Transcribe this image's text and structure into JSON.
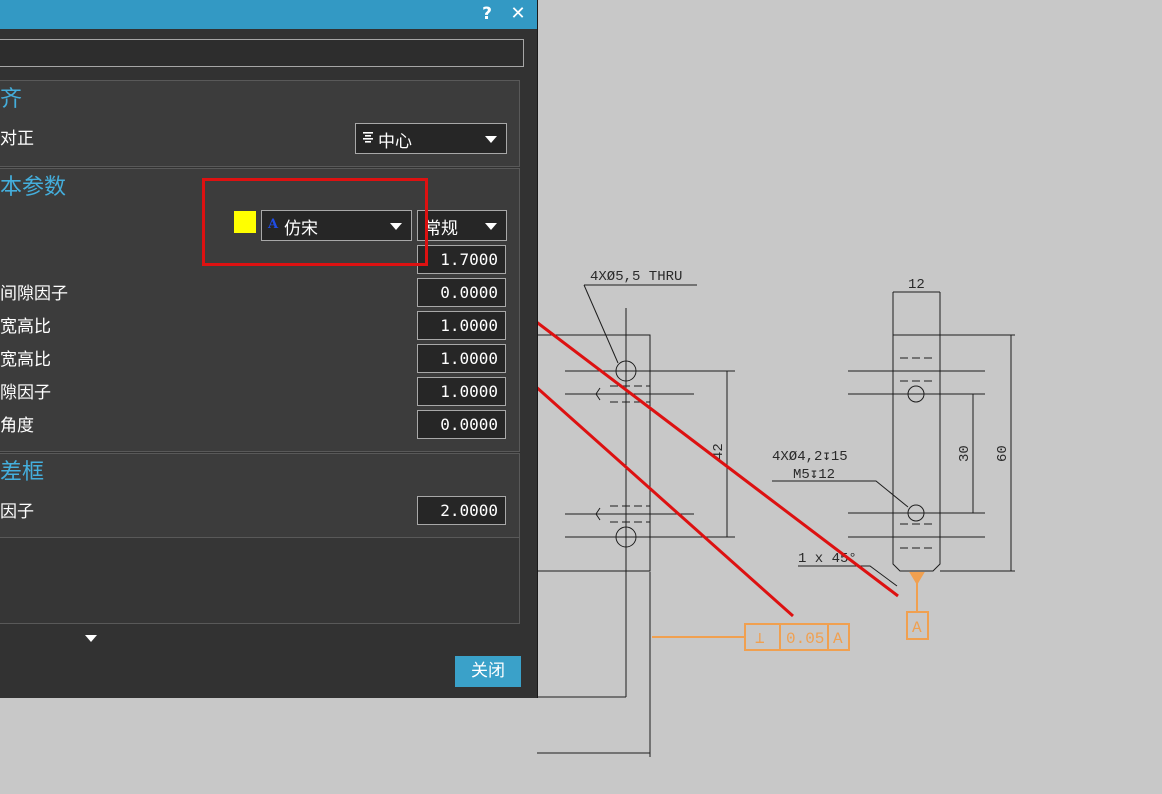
{
  "dialog": {
    "help_label": "?",
    "close_x_label": "✕",
    "sections": {
      "align_title": "齐",
      "text_params_title": "本参数",
      "frame_title": "差框"
    },
    "align": {
      "justify_label": "对正",
      "justify_value": "中心"
    },
    "text_params": {
      "font_value": "仿宋",
      "style_value": "常规",
      "height_value": "1.7000",
      "rows": [
        {
          "label": "间隙因子",
          "value": "0.0000"
        },
        {
          "label": "宽高比",
          "value": "1.0000"
        },
        {
          "label": "宽高比",
          "value": "1.0000"
        },
        {
          "label": "隙因子",
          "value": "1.0000"
        },
        {
          "label": "角度",
          "value": "0.0000"
        }
      ]
    },
    "frame": {
      "factor_label": "因子",
      "factor_value": "2.0000"
    },
    "close_button_label": "关闭"
  },
  "drawing": {
    "callout_thru": "4XØ5,5 THRU",
    "dim_12": "12",
    "dim_42": "42",
    "callout_hole_1": "4XØ4,2↧15",
    "callout_hole_2": "M5↧12",
    "dim_30": "30",
    "dim_60": "60",
    "chamfer": "1 x 45°",
    "tolerance_symbol": "⊥",
    "tolerance_value": "0.05",
    "tolerance_datum": "A",
    "datum_label": "A"
  },
  "colors": {
    "title_bar": "#3399c4",
    "section_title": "#44aedc",
    "annotation_orange": "#f0a050",
    "highlight_red": "#dd1111"
  }
}
